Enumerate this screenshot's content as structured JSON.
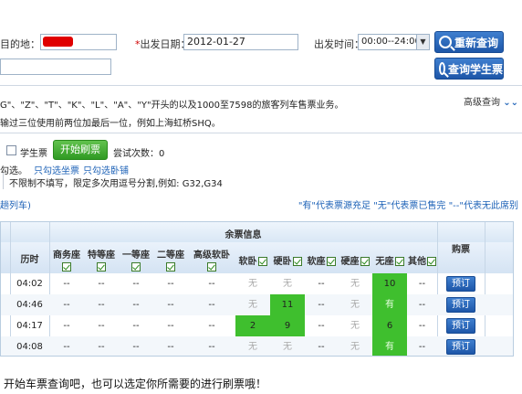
{
  "form": {
    "destination_label": "目的地：",
    "date_label": "出发日期：",
    "date_value": "2012-01-27",
    "time_label": "出发时间：",
    "time_value": "00:00--24:00",
    "search_button": "重新查询",
    "student_search_button": "查询学生票"
  },
  "info": {
    "line1": "G\"、\"Z\"、\"T\"、\"K\"、\"L\"、\"A\"、\"Y\"开头的以及1000至7598的旅客列车售票业务。",
    "line2": "输过三位使用前两位加最后一位，例如上海虹桥SHQ。",
    "advanced_label": "高级查询"
  },
  "controls": {
    "student_ticket_label": "学生票",
    "start_brush_button": "开始刷票",
    "attempts_label": "尝试次数：0",
    "check_prefix": "勾选。",
    "only_seats_link": "只勾选坐票",
    "only_sleepers_link": "只勾选卧铺",
    "train_filter_hint": "不限制不填写，限定多次用逗号分割,例如: G32,G34"
  },
  "legend": {
    "left_tail": "趟列车)",
    "text": "\"有\"代表票源充足 \"无\"代表票已售完 \"--\"代表无此席别"
  },
  "table": {
    "group_header": "余票信息",
    "book_header": "购票",
    "headers": [
      "历时",
      "商务座",
      "特等座",
      "一等座",
      "二等座",
      "高级软卧",
      "软卧",
      "硬卧",
      "软座",
      "硬座",
      "无座",
      "其他"
    ],
    "rows": [
      {
        "duration": "04:02",
        "cells": [
          "--",
          "--",
          "--",
          "--",
          "--",
          "无",
          "无",
          "--",
          "无",
          "10",
          "--"
        ],
        "book": "预订"
      },
      {
        "duration": "04:46",
        "cells": [
          "--",
          "--",
          "--",
          "--",
          "--",
          "无",
          "11",
          "--",
          "无",
          "有",
          "--"
        ],
        "book": "预订"
      },
      {
        "duration": "04:17",
        "cells": [
          "--",
          "--",
          "--",
          "--",
          "--",
          "2",
          "9",
          "--",
          "无",
          "6",
          "--"
        ],
        "book": "预订"
      },
      {
        "duration": "04:08",
        "cells": [
          "--",
          "--",
          "--",
          "--",
          "--",
          "无",
          "无",
          "--",
          "无",
          "有",
          "--"
        ],
        "book": "预订"
      }
    ]
  },
  "caption": "开始车票查询吧，也可以选定你所需要的进行刷票哦！",
  "colors": {
    "accent_blue": "#1d56a8",
    "brush_green": "#2f9a22",
    "available_green": "#3fbf2e"
  }
}
